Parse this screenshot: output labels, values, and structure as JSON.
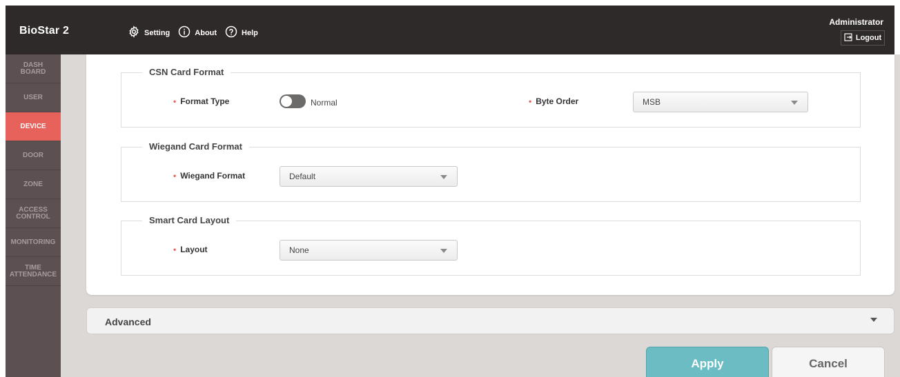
{
  "header": {
    "brand": "BioStar 2",
    "nav": [
      {
        "label": "Setting",
        "icon": "gear-icon"
      },
      {
        "label": "About",
        "icon": "info-icon"
      },
      {
        "label": "Help",
        "icon": "help-icon"
      }
    ],
    "user": "Administrator",
    "logout_label": "Logout"
  },
  "sidebar": {
    "items": [
      {
        "label": "DASH\nBOARD",
        "active": false
      },
      {
        "label": "USER",
        "active": false
      },
      {
        "label": "DEVICE",
        "active": true
      },
      {
        "label": "DOOR",
        "active": false
      },
      {
        "label": "ZONE",
        "active": false
      },
      {
        "label": "ACCESS\nCONTROL",
        "active": false
      },
      {
        "label": "MONITORING",
        "active": false
      },
      {
        "label": "TIME\nATTENDANCE",
        "active": false
      }
    ]
  },
  "csn": {
    "title": "CSN Card Format",
    "format_type_label": "Format Type",
    "format_type_value": "Normal",
    "byte_order_label": "Byte Order",
    "byte_order_value": "MSB"
  },
  "wiegand": {
    "title": "Wiegand Card Format",
    "format_label": "Wiegand Format",
    "format_value": "Default"
  },
  "smart": {
    "title": "Smart Card Layout",
    "layout_label": "Layout",
    "layout_value": "None"
  },
  "advanced": {
    "label": "Advanced"
  },
  "footer": {
    "apply_label": "Apply",
    "cancel_label": "Cancel"
  },
  "colors": {
    "header_bg": "#2e2a29",
    "sidebar_bg": "#5d5053",
    "active_item": "#e8625c",
    "apply_button": "#6bbcc3",
    "required_marker": "#e8625c"
  }
}
